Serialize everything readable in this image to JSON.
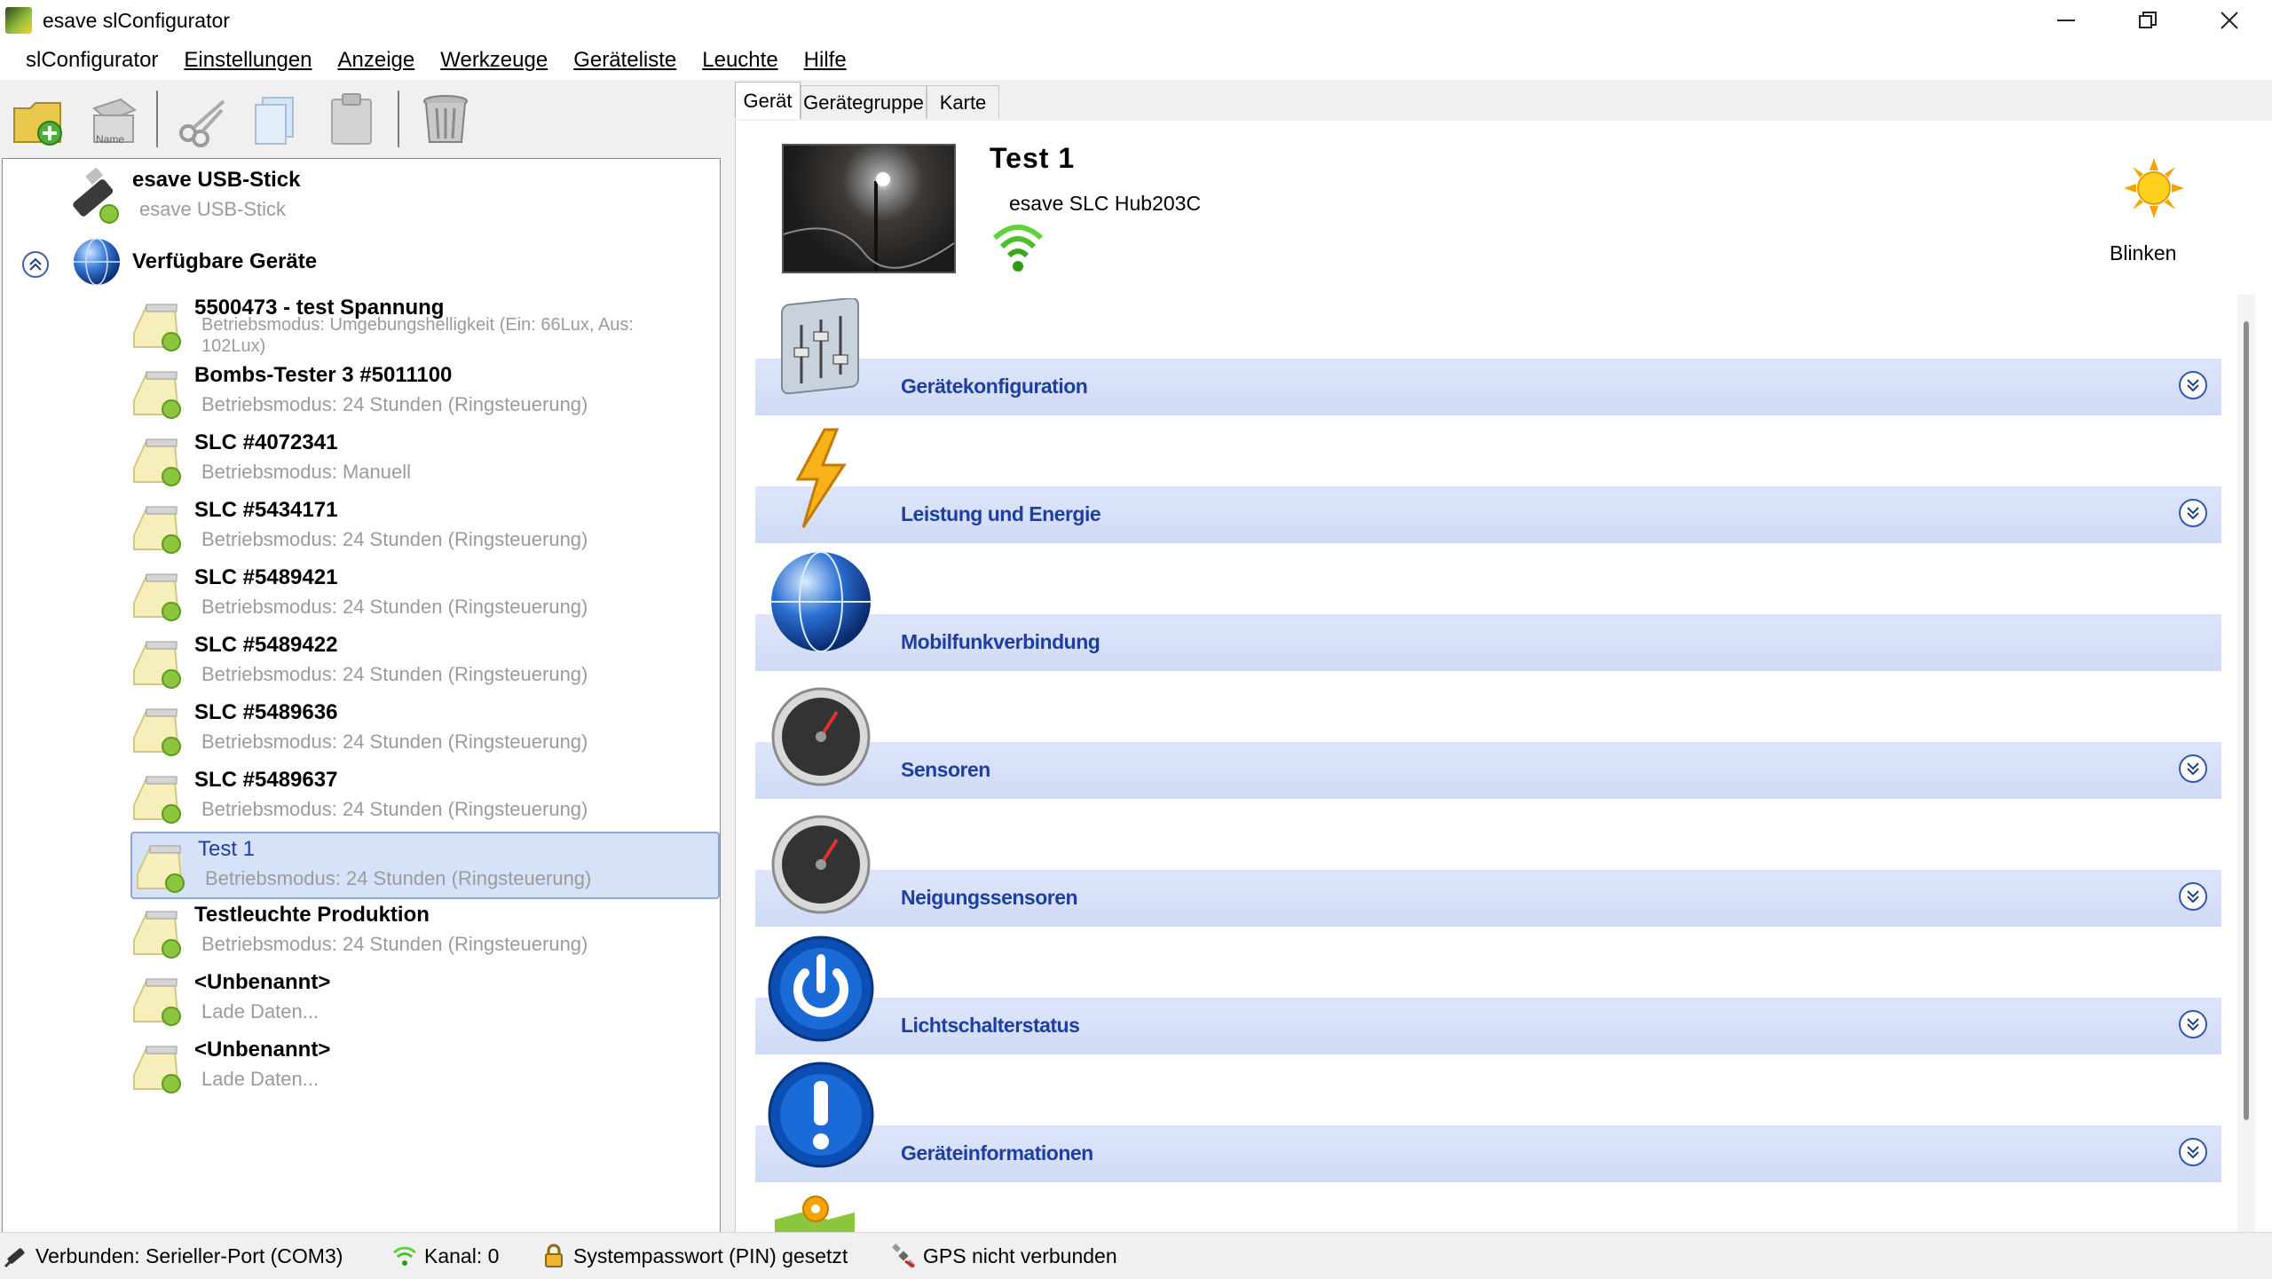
{
  "window": {
    "title": "esave slConfigurator"
  },
  "menu": [
    "slConfigurator",
    "Einstellungen",
    "Anzeige",
    "Werkzeuge",
    "Geräteliste",
    "Leuchte",
    "Hilfe"
  ],
  "toolbar": {
    "new_tooltip": "",
    "name_label": "Name"
  },
  "tree": {
    "usb": {
      "title": "esave USB-Stick",
      "subtitle": "esave USB-Stick"
    },
    "group": {
      "title": "Verfügbare Geräte"
    },
    "devices": [
      {
        "title": "5500473 - test Spannung",
        "subtitle": "Betriebsmodus: Umgebungshelligkeit (Ein: 66Lux, Aus:",
        "subtitle2": "102Lux)"
      },
      {
        "title": "Bombs-Tester 3 #5011100",
        "subtitle": "Betriebsmodus: 24 Stunden (Ringsteuerung)"
      },
      {
        "title": "SLC #4072341",
        "subtitle": "Betriebsmodus: Manuell"
      },
      {
        "title": "SLC #5434171",
        "subtitle": "Betriebsmodus: 24 Stunden (Ringsteuerung)"
      },
      {
        "title": "SLC #5489421",
        "subtitle": "Betriebsmodus: 24 Stunden (Ringsteuerung)"
      },
      {
        "title": "SLC #5489422",
        "subtitle": "Betriebsmodus: 24 Stunden (Ringsteuerung)"
      },
      {
        "title": "SLC #5489636",
        "subtitle": "Betriebsmodus: 24 Stunden (Ringsteuerung)"
      },
      {
        "title": "SLC #5489637",
        "subtitle": "Betriebsmodus: 24 Stunden (Ringsteuerung)"
      },
      {
        "title": "Test 1",
        "subtitle": "Betriebsmodus: 24 Stunden (Ringsteuerung)"
      },
      {
        "title": "Testleuchte Produktion",
        "subtitle": "Betriebsmodus: 24 Stunden (Ringsteuerung)"
      },
      {
        "title": "<Unbenannt>",
        "subtitle": "Lade Daten..."
      },
      {
        "title": "<Unbenannt>",
        "subtitle": "Lade Daten..."
      }
    ]
  },
  "tabs": [
    "Gerät",
    "Gerätegruppe",
    "Karte"
  ],
  "device": {
    "name": "Test 1",
    "model": "esave SLC Hub203C",
    "blink_label": "Blinken"
  },
  "sections": [
    "Gerätekonfiguration",
    "Leistung und Energie",
    "Mobilfunkverbindung",
    "Sensoren",
    "Neigungssensoren",
    "Lichtschalterstatus",
    "Geräteinformationen"
  ],
  "status": {
    "connection": "Verbunden: Serieller-Port (COM3)",
    "channel": "Kanal: 0",
    "pin": "Systempasswort (PIN) gesetzt",
    "gps": "GPS nicht verbunden"
  },
  "colors": {
    "selection": "#d6e2f7",
    "section_bar": "#d6e0f8",
    "section_text": "#1f3f9e"
  }
}
